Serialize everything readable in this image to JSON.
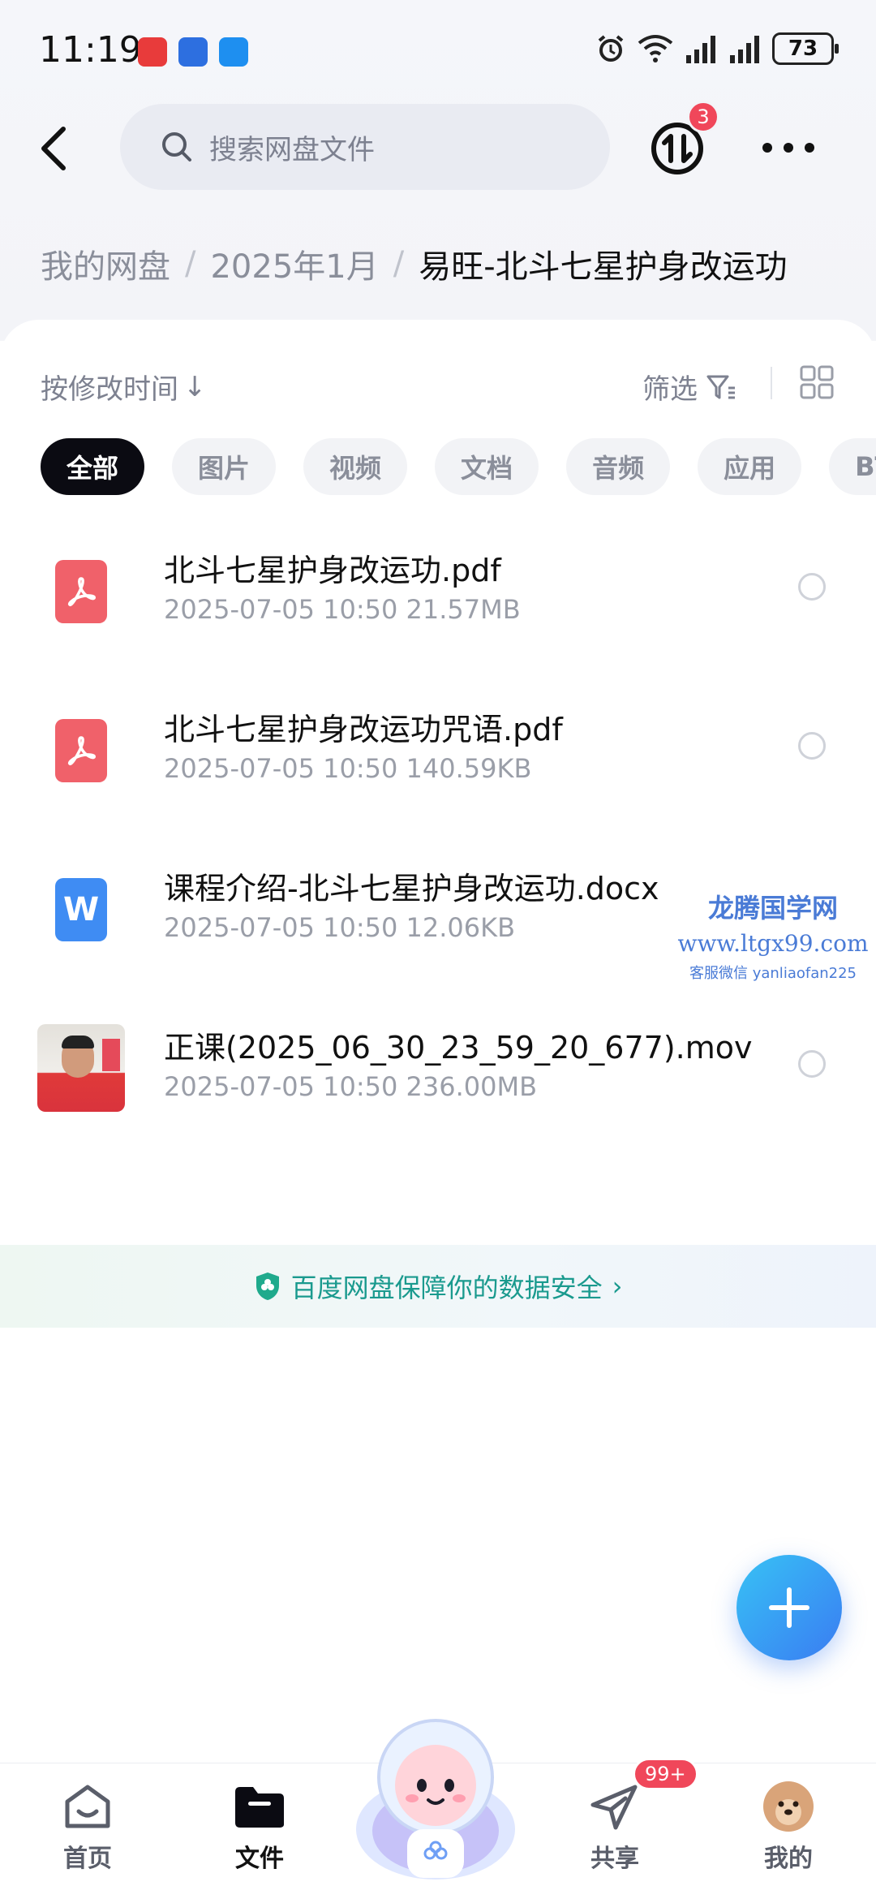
{
  "status_bar": {
    "time": "11:19",
    "battery": "73"
  },
  "header": {
    "search_placeholder": "搜索网盘文件",
    "transfer_badge": "3"
  },
  "breadcrumb": {
    "items": [
      "我的网盘",
      "2025年1月"
    ],
    "current": "易旺-北斗七星护身改运功"
  },
  "toolbar": {
    "sort_label": "按修改时间",
    "sort_arrow": "↓",
    "filter_label": "筛选"
  },
  "categories": [
    "全部",
    "图片",
    "视频",
    "文档",
    "音频",
    "应用",
    "BT"
  ],
  "files": [
    {
      "name": "北斗七星护身改运功.pdf",
      "meta": "2025-07-05  10:50   21.57MB",
      "icon": "pdf-icon"
    },
    {
      "name": "北斗七星护身改运功咒语.pdf",
      "meta": "2025-07-05  10:50   140.59KB",
      "icon": "pdf-icon"
    },
    {
      "name": "课程介绍-北斗七星护身改运功.docx",
      "meta": "2025-07-05  10:50   12.06KB",
      "icon": "word-doc-icon"
    },
    {
      "name": "正课(2025_06_30_23_59_20_677).mov",
      "meta": "2025-07-05  10:50   236.00MB",
      "icon": "video-thumbnail"
    }
  ],
  "watermark": {
    "line1": "龙腾国学网",
    "line2": "www.ltgx99.com",
    "line3": "客服微信 yanliaofan225"
  },
  "security_banner": {
    "text": "百度网盘保障你的数据安全",
    "arrow": "›"
  },
  "bottom_nav": {
    "items": [
      {
        "label": "首页",
        "icon": "home-icon"
      },
      {
        "label": "文件",
        "icon": "folder-icon"
      },
      {
        "label": "共享",
        "icon": "share-plane-icon"
      },
      {
        "label": "我的",
        "icon": "avatar-icon"
      }
    ],
    "share_badge": "99+"
  },
  "colors": {
    "accent": "#3a7cf2",
    "badge": "#f0475a",
    "security": "#1a9a8e"
  }
}
